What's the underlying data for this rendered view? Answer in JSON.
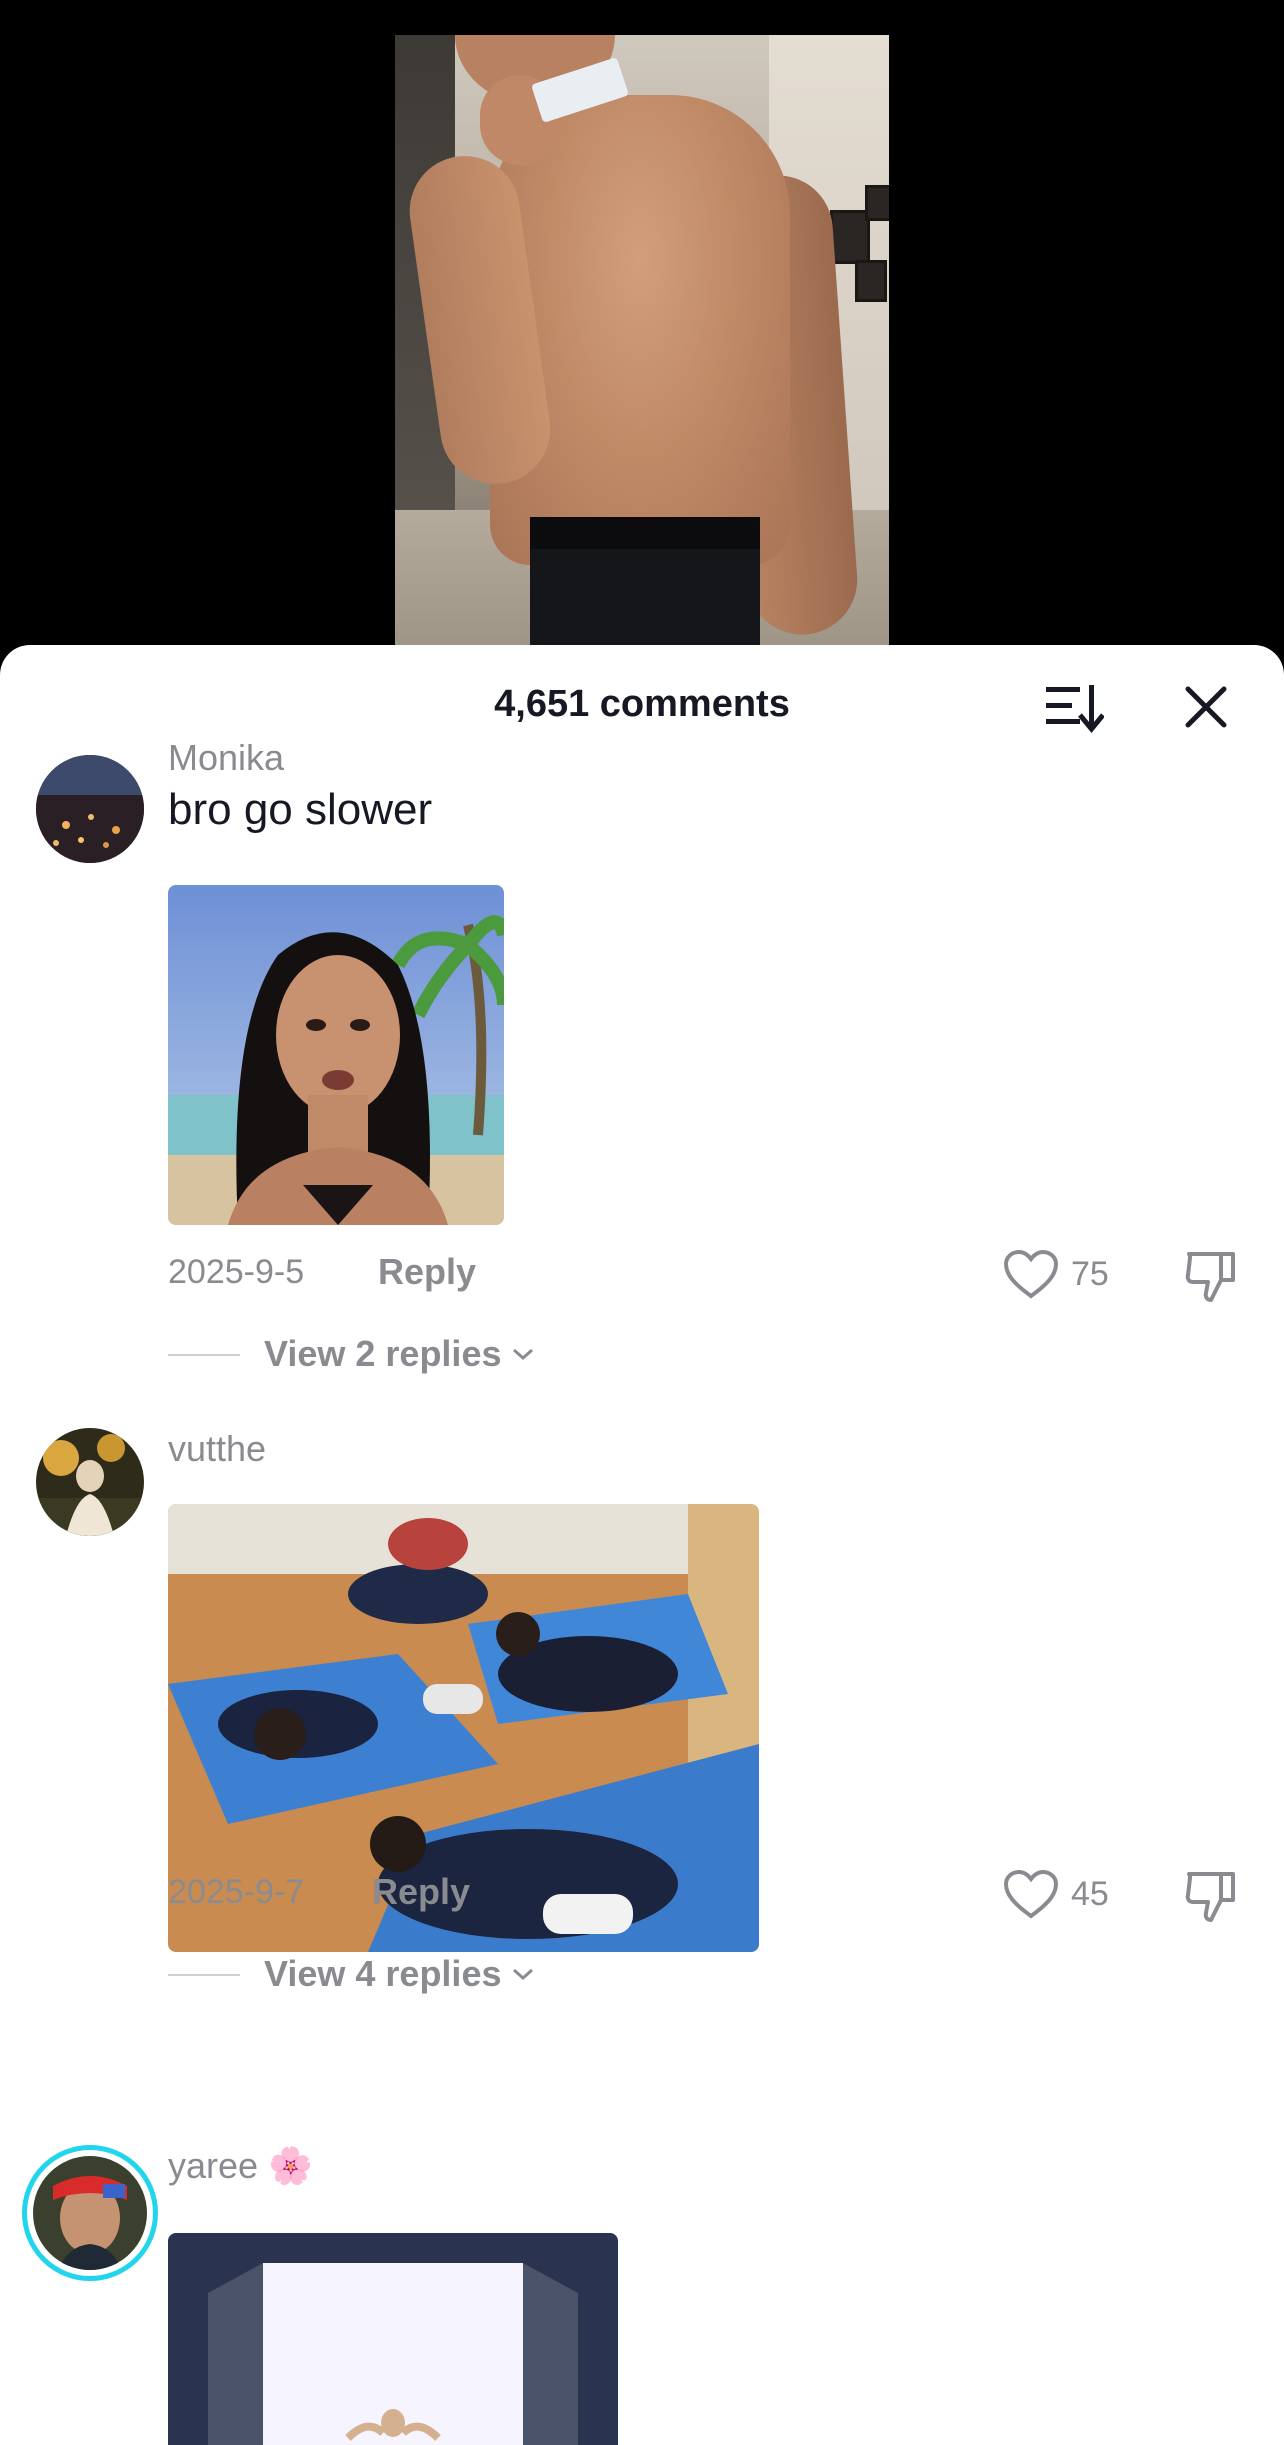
{
  "sheet": {
    "title": "4,651 comments"
  },
  "comments": [
    {
      "username": "Monika",
      "text": "bro go slower",
      "date": "2025-9-5",
      "reply_label": "Reply",
      "likes": "75",
      "view_replies": "View 2 replies"
    },
    {
      "username": "vutthe",
      "text": "",
      "date": "2025-9-7",
      "reply_label": "Reply",
      "likes": "45",
      "view_replies": "View 4 replies"
    },
    {
      "username": "yaree 🌸",
      "text": ""
    }
  ],
  "colors": {
    "background": "#000000",
    "sheet": "#ffffff",
    "muted_text": "#8a8b91",
    "primary_text": "#161823",
    "story_ring": "#20d5ec"
  },
  "icons": [
    "sort-icon",
    "close-icon",
    "heart-icon",
    "dislike-icon",
    "chevron-down-icon"
  ]
}
